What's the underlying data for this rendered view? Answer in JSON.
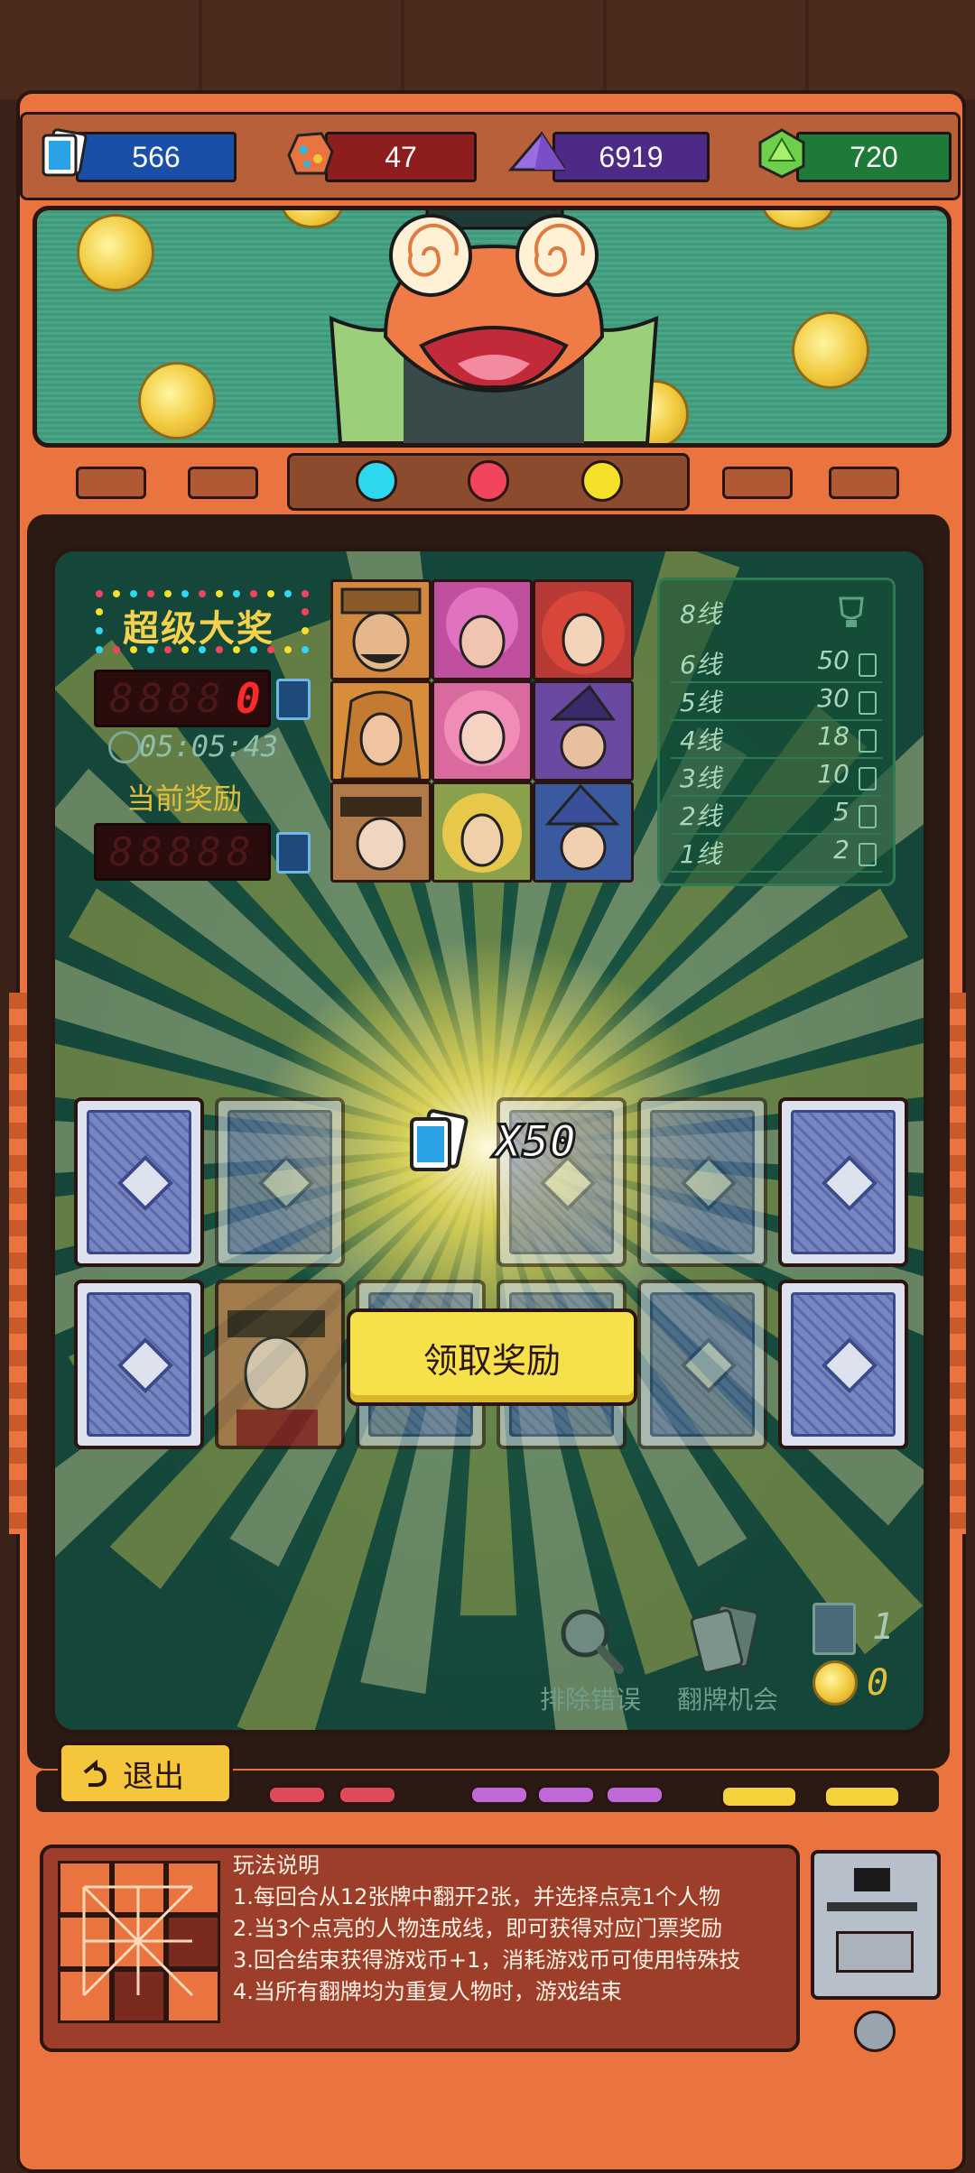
{
  "currencies": [
    {
      "icon": "ticket-icon",
      "value": "566",
      "color": "#1a4fa8"
    },
    {
      "icon": "ore-icon",
      "value": "47",
      "color": "#8e1e1e"
    },
    {
      "icon": "purple-crystal-icon",
      "value": "6919",
      "color": "#4d2a86"
    },
    {
      "icon": "green-gem-icon",
      "value": "720",
      "color": "#1f7a3a"
    }
  ],
  "jackpot": {
    "title": "超级大奖",
    "value": "0",
    "timer": "05:05:43",
    "current_label": "当前奖励",
    "current_value": ""
  },
  "lines": [
    {
      "label": "8线",
      "value": ""
    },
    {
      "label": "6线",
      "value": "50"
    },
    {
      "label": "5线",
      "value": "30"
    },
    {
      "label": "4线",
      "value": "18"
    },
    {
      "label": "3线",
      "value": "10"
    },
    {
      "label": "2线",
      "value": "5"
    },
    {
      "label": "1线",
      "value": "2"
    }
  ],
  "reward": {
    "multiplier": "X50",
    "claim_label": "领取奖励"
  },
  "tools": {
    "remove_error_label": "排除错误",
    "flip_chance_label": "翻牌机会",
    "flip_count": "1",
    "coin_count": "0"
  },
  "exit_label": "退出",
  "rules": {
    "title": "玩法说明",
    "items": [
      "1.每回合从12张牌中翻开2张，并选择点亮1个人物",
      "2.当3个点亮的人物连成线，即可获得对应门票奖励",
      "3.回合结束获得游戏币+1，消耗游戏币可使用特殊技",
      "4.当所有翻牌均为重复人物时，游戏结束"
    ]
  },
  "colors": {
    "accent": "#f7e14a",
    "cabinet": "#e9743f",
    "panel": "#14473a"
  }
}
